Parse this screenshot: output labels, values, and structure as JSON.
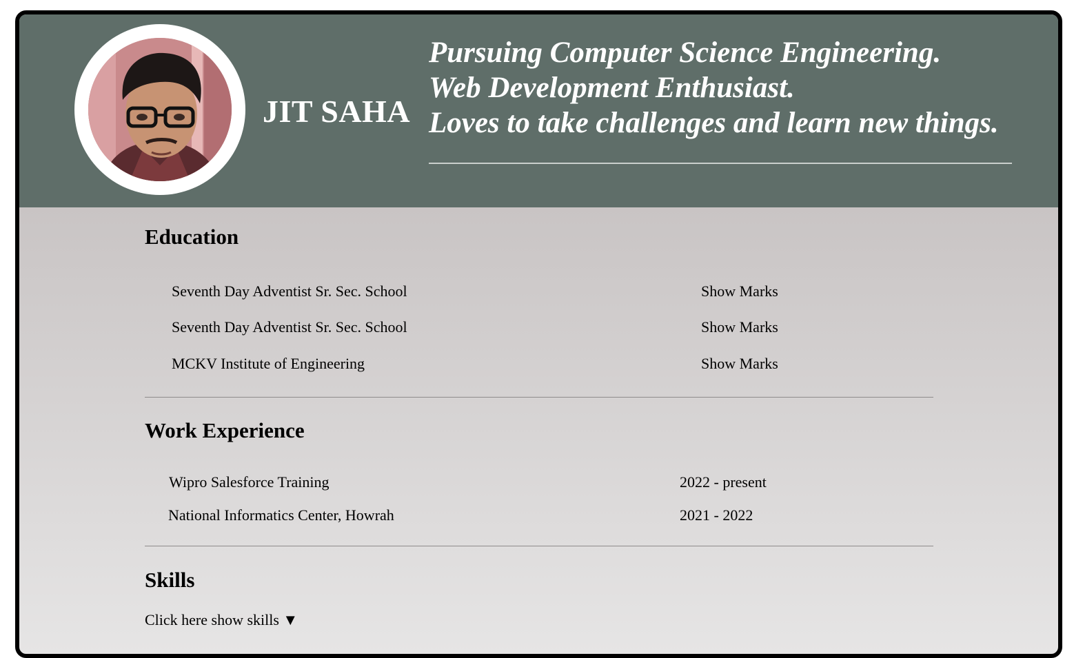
{
  "profile": {
    "name": "JIT SAHA",
    "photo": "profile-photo",
    "tagline": [
      "Pursuing Computer Science Engineering.",
      "Web Development Enthusiast.",
      "Loves to take challenges and learn new things."
    ]
  },
  "education": {
    "title": "Education",
    "items": [
      {
        "institution": "Seventh Day Adventist Sr. Sec. School",
        "action": "Show Marks"
      },
      {
        "institution": "Seventh Day Adventist Sr. Sec. School",
        "action": "Show Marks"
      },
      {
        "institution": "MCKV Institute of Engineering",
        "action": "Show Marks"
      }
    ]
  },
  "work": {
    "title": "Work Experience",
    "items": [
      {
        "organization": "Wipro Salesforce Training",
        "period": "2022 - present"
      },
      {
        "organization": "National Informatics Center, Howrah",
        "period": "2021 - 2022"
      }
    ]
  },
  "skills": {
    "title": "Skills",
    "toggle_label": "Click here show skills ▼"
  },
  "colors": {
    "header_bg": "#5f6e69",
    "body_gradient_top": "#bcb6b6",
    "body_gradient_bottom": "#e6e5e5",
    "frame_border": "#000000",
    "header_text": "#ffffff"
  }
}
